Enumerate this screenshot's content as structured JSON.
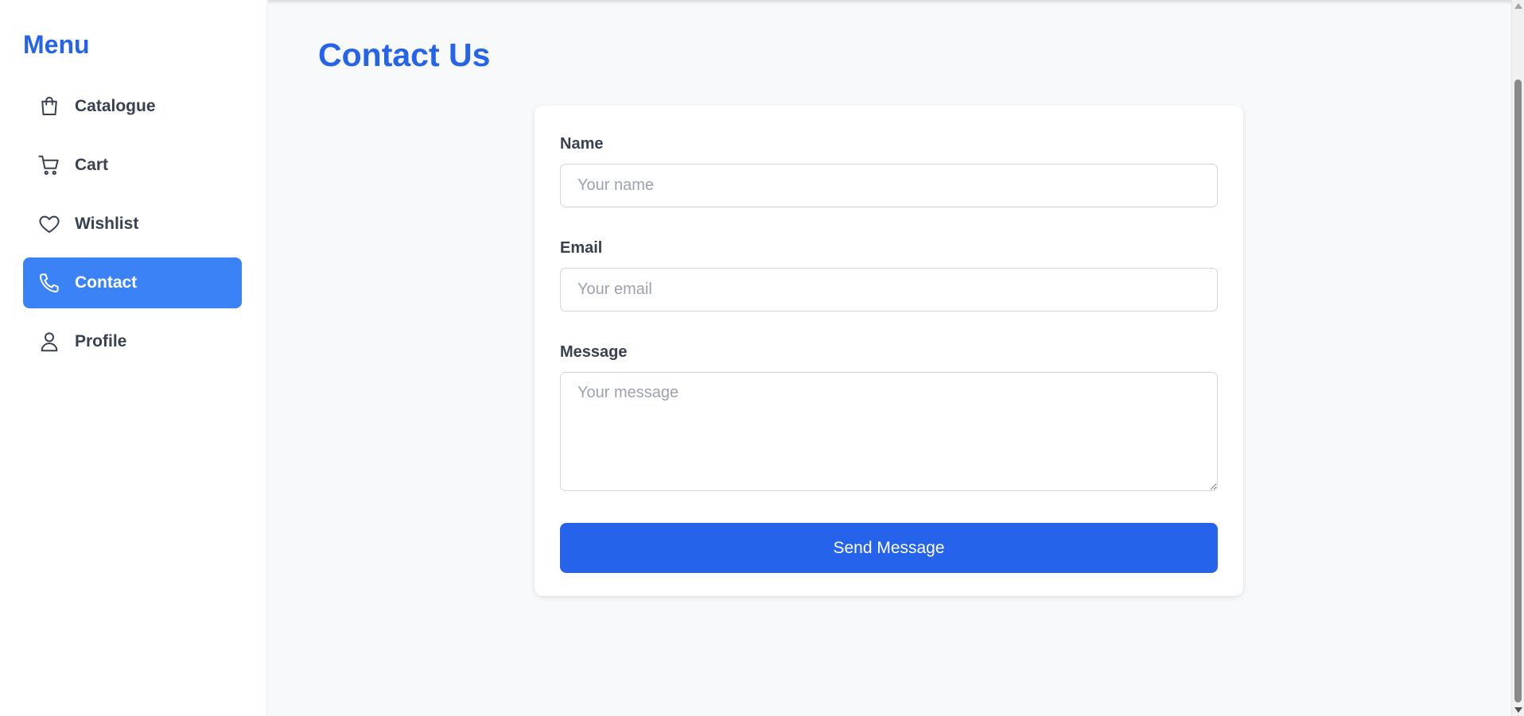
{
  "sidebar": {
    "title": "Menu",
    "items": [
      {
        "label": "Catalogue",
        "icon": "shopping-bag-icon",
        "active": false
      },
      {
        "label": "Cart",
        "icon": "cart-icon",
        "active": false
      },
      {
        "label": "Wishlist",
        "icon": "heart-icon",
        "active": false
      },
      {
        "label": "Contact",
        "icon": "phone-icon",
        "active": true
      },
      {
        "label": "Profile",
        "icon": "user-icon",
        "active": false
      }
    ]
  },
  "main": {
    "title": "Contact Us",
    "form": {
      "name_label": "Name",
      "name_placeholder": "Your name",
      "email_label": "Email",
      "email_placeholder": "Your email",
      "message_label": "Message",
      "message_placeholder": "Your message",
      "submit_label": "Send Message"
    }
  },
  "colors": {
    "accent": "#2563eb",
    "active_nav": "#3b82f6",
    "background": "#f8f9fb"
  }
}
